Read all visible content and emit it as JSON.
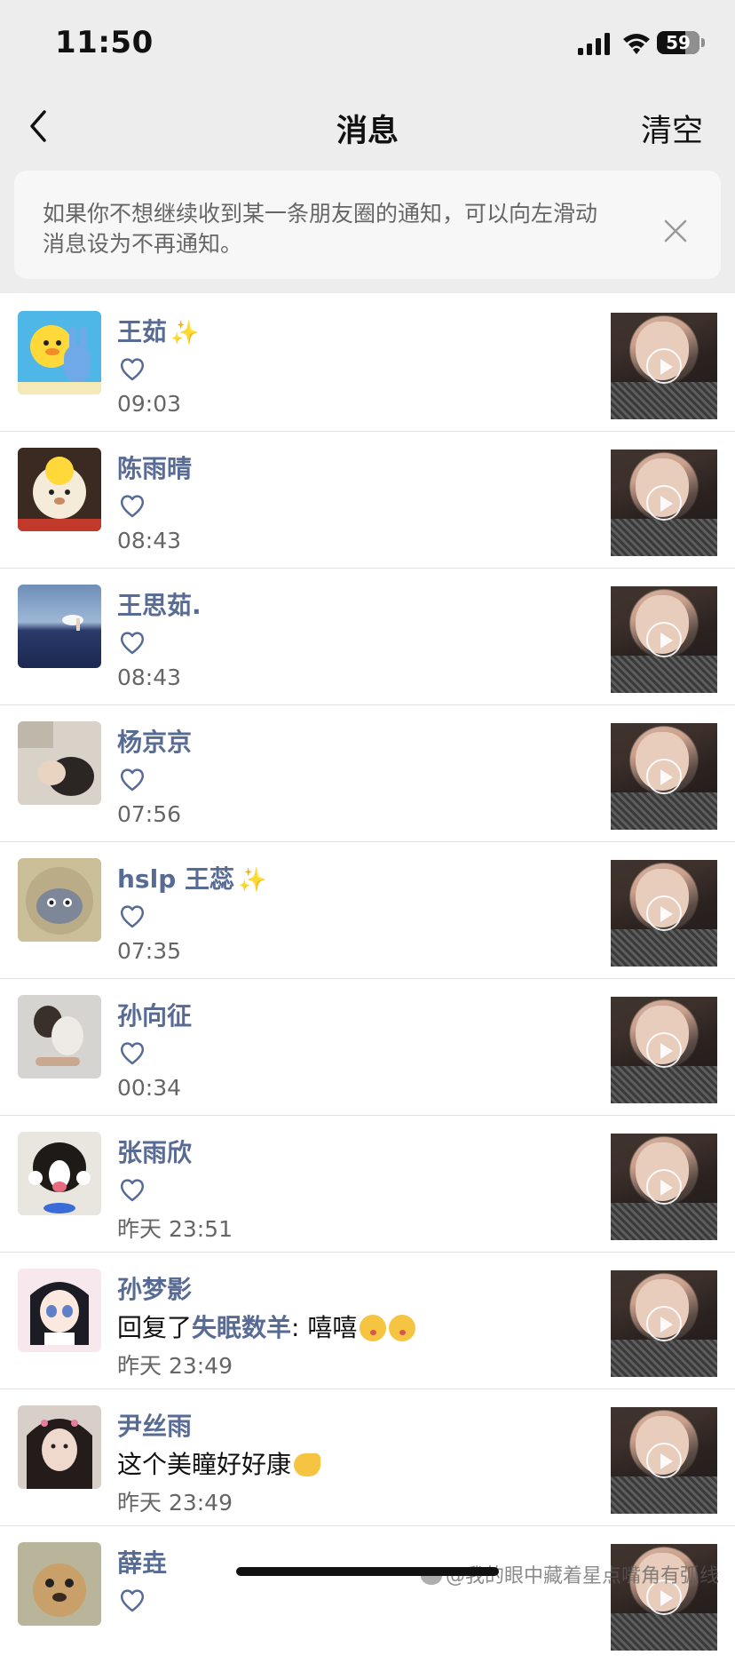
{
  "status_bar": {
    "time": "11:50",
    "battery": "59"
  },
  "nav": {
    "title": "消息",
    "clear_label": "清空"
  },
  "tip": {
    "text": "如果你不想继续收到某一条朋友圈的通知，可以向左滑动消息设为不再通知。"
  },
  "colors": {
    "name_link": "#576b95",
    "background_top": "#ededed",
    "text_secondary": "#666666"
  },
  "messages": [
    {
      "name": "王茹",
      "sparkle": "✨",
      "type": "like",
      "time": "09:03",
      "avatar": "yellow-duck-avatar"
    },
    {
      "name": "陈雨晴",
      "type": "like",
      "time": "08:43",
      "avatar": "plush-bear-avatar"
    },
    {
      "name": "王思茹.",
      "type": "like",
      "time": "08:43",
      "avatar": "blue-sky-avatar"
    },
    {
      "name": "杨京京",
      "type": "like",
      "time": "07:56",
      "avatar": "sleeping-person-avatar"
    },
    {
      "name": "hslp 王蕊",
      "sparkle": "✨",
      "type": "like",
      "time": "07:35",
      "avatar": "fluffy-creature-avatar"
    },
    {
      "name": "孙向征",
      "type": "like",
      "time": "00:34",
      "avatar": "lying-person-avatar"
    },
    {
      "name": "张雨欣",
      "type": "like",
      "time": "昨天 23:51",
      "avatar": "dog-avatar"
    },
    {
      "name": "孙梦影",
      "type": "comment",
      "reply_prefix": "回复了",
      "reply_to": "失眠数羊",
      "reply_text": ": 嘻嘻",
      "emoji": "kissing-face-emoji",
      "emoji_count": 2,
      "time": "昨天 23:49",
      "avatar": "anime-girl-avatar"
    },
    {
      "name": "尹丝雨",
      "type": "comment",
      "comment_text": "这个美瞳好好康",
      "emoji": "clapping-hand-emoji",
      "time": "昨天 23:49",
      "avatar": "girl-selfie-avatar"
    },
    {
      "name": "薛垚",
      "type": "like",
      "time": "",
      "avatar": "puppy-avatar"
    }
  ],
  "watermark": "@我的眼中藏着星点嘴角有弧线"
}
